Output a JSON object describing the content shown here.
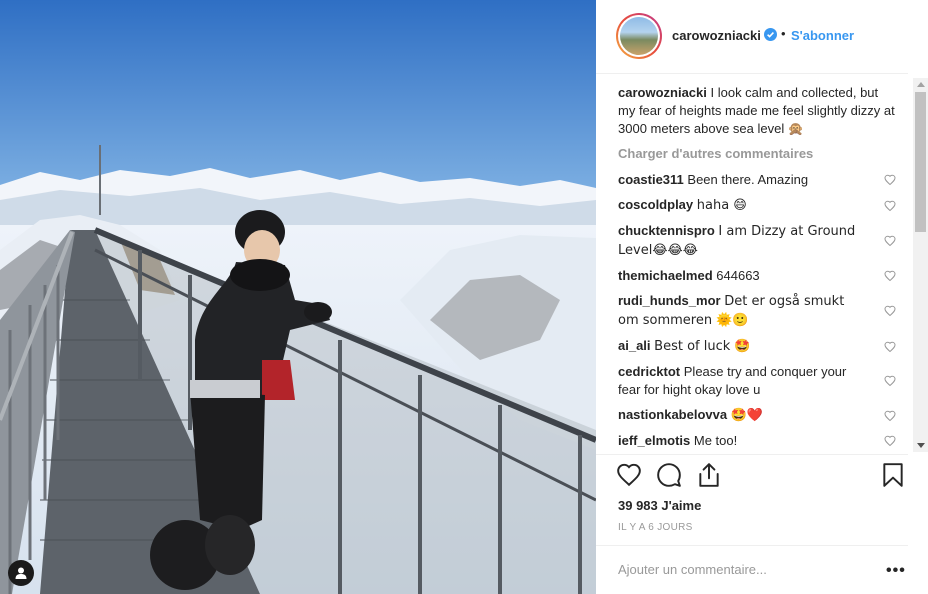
{
  "post": {
    "username": "carowozniacki",
    "follow_label": "S'abonner",
    "dot": "•",
    "caption_user": "carowozniacki",
    "caption_text": "I look calm and collected, but my fear of heights made me feel slightly dizzy at 3000 meters above sea level 🙊",
    "load_more": "Charger d'autres commentaires",
    "comments": [
      {
        "user": "coastie311",
        "text": "Been there. Amazing"
      },
      {
        "user": "coscoldplay",
        "text": "haha 😄"
      },
      {
        "user": "chucktennispro",
        "text": "I am Dizzy at Ground Level😂😂😂"
      },
      {
        "user": "themichaelmed",
        "text": "644663"
      },
      {
        "user": "rudi_hunds_mor",
        "text": "Det er også smukt om sommeren 🌞🙂"
      },
      {
        "user": "ai_ali",
        "text": "Best of luck 🤩"
      },
      {
        "user": "cedricktot",
        "text": "Please try and conquer your fear for hight okay love u"
      },
      {
        "user": "nastionkabelovva",
        "text": "🤩❤️"
      },
      {
        "user": "ieff_elmotis",
        "text": "Me too!"
      }
    ],
    "likes": "39 983 J'aime",
    "time": "IL Y A 6 JOURS",
    "add_comment_placeholder": "Ajouter un commentaire...",
    "more": "•••"
  },
  "icons": {
    "verified": "verified-badge-icon",
    "heart": "heart-icon",
    "comment": "comment-icon",
    "share": "share-icon",
    "bookmark": "bookmark-icon",
    "user_tag": "user-tag-icon",
    "more": "more-options-icon"
  },
  "colors": {
    "accent": "#3897f0",
    "text": "#262626",
    "muted": "#999999"
  }
}
